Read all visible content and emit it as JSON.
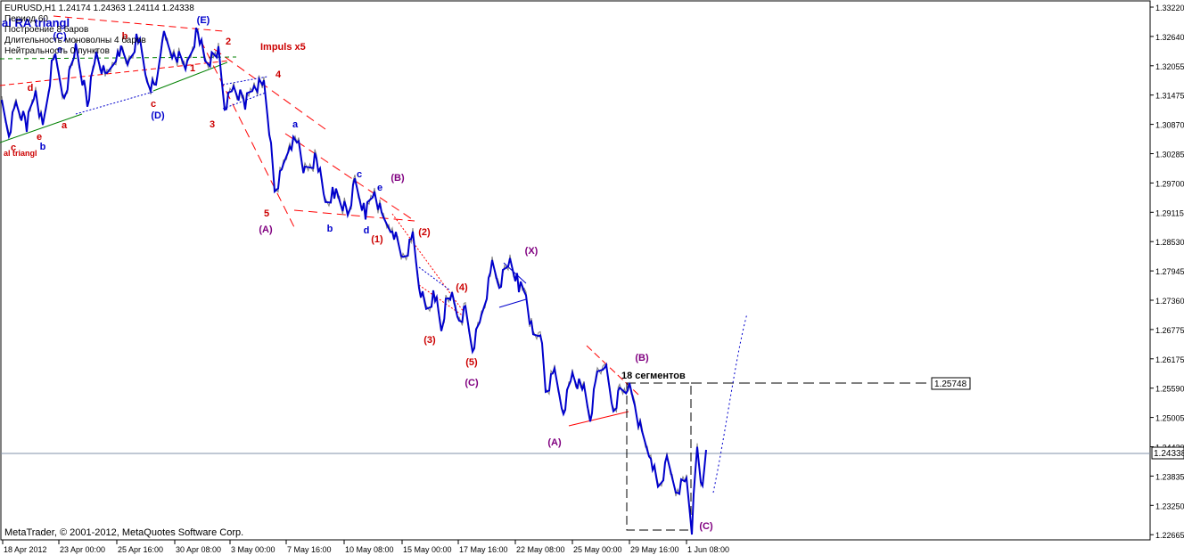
{
  "header": {
    "symbol_line": "EURUSD,H1  1.24174 1.24363 1.24114 1.24338",
    "period": "Период  60",
    "build": "Построение   8 баров",
    "mono_len": "Длительность моноволны   4  баров",
    "neutral": "Нейтральность   0  пунктов"
  },
  "footer": {
    "copyright": "MetaTrader, © 2001-2012, MetaQuotes Software Corp."
  },
  "price_axis": {
    "ticks": [
      "1.33220",
      "1.32640",
      "1.32055",
      "1.31475",
      "1.30870",
      "1.30285",
      "1.29700",
      "1.29115",
      "1.28530",
      "1.27945",
      "1.27360",
      "1.26775",
      "1.26175",
      "1.25590",
      "1.25005",
      "1.24420",
      "1.23835",
      "1.23250",
      "1.22665"
    ],
    "current_price": "1.24338",
    "level_label": "1.25748"
  },
  "time_axis": {
    "ticks": [
      "18 Apr 2012",
      "23 Apr 00:00",
      "25 Apr 16:00",
      "30 Apr 08:00",
      "3 May 00:00",
      "7 May 16:00",
      "10 May 08:00",
      "15 May 00:00",
      "17 May 16:00",
      "22 May 08:00",
      "25 May 00:00",
      "29 May 16:00",
      "1 Jun 08:00"
    ]
  },
  "annotations": {
    "triangle_title": "al RA  triangl",
    "triangle_bottom": "al triangl",
    "impulse_title": "Impuls x5",
    "segments": "18 сегментов",
    "waves": [
      {
        "t": "(E)",
        "c": "#0000cc"
      },
      {
        "t": "(C)",
        "c": "#0000cc"
      },
      {
        "t": "(D)",
        "c": "#0000cc"
      },
      {
        "t": "b",
        "c": "#cc0000"
      },
      {
        "t": "d",
        "c": "#cc0000"
      },
      {
        "t": "a",
        "c": "#cc0000"
      },
      {
        "t": "c",
        "c": "#cc0000"
      },
      {
        "t": "c",
        "c": "#cc0000"
      },
      {
        "t": "e",
        "c": "#cc0000"
      },
      {
        "t": "b",
        "c": "#0000cc"
      },
      {
        "t": "e",
        "c": "#0000cc"
      },
      {
        "t": "1",
        "c": "#cc0000"
      },
      {
        "t": "2",
        "c": "#cc0000"
      },
      {
        "t": "3",
        "c": "#cc0000"
      },
      {
        "t": "4",
        "c": "#cc0000"
      },
      {
        "t": "5",
        "c": "#cc0000"
      },
      {
        "t": "(A)",
        "c": "#800080"
      },
      {
        "t": "a",
        "c": "#0000cc"
      },
      {
        "t": "b",
        "c": "#0000cc"
      },
      {
        "t": "c",
        "c": "#0000cc"
      },
      {
        "t": "d",
        "c": "#0000cc"
      },
      {
        "t": "e",
        "c": "#0000cc"
      },
      {
        "t": "(B)",
        "c": "#800080"
      },
      {
        "t": "(1)",
        "c": "#cc0000"
      },
      {
        "t": "(2)",
        "c": "#cc0000"
      },
      {
        "t": "(3)",
        "c": "#cc0000"
      },
      {
        "t": "(4)",
        "c": "#cc0000"
      },
      {
        "t": "(5)",
        "c": "#cc0000"
      },
      {
        "t": "(C)",
        "c": "#800080"
      },
      {
        "t": "(X)",
        "c": "#800080"
      },
      {
        "t": "(A)",
        "c": "#800080"
      },
      {
        "t": "(B)",
        "c": "#800080"
      },
      {
        "t": "(C)",
        "c": "#800080"
      }
    ]
  },
  "colors": {
    "price_line": "#0000cc",
    "wick": "#808080",
    "channel": "#ff0000",
    "green_line": "#008000",
    "grid_text": "#000000"
  }
}
